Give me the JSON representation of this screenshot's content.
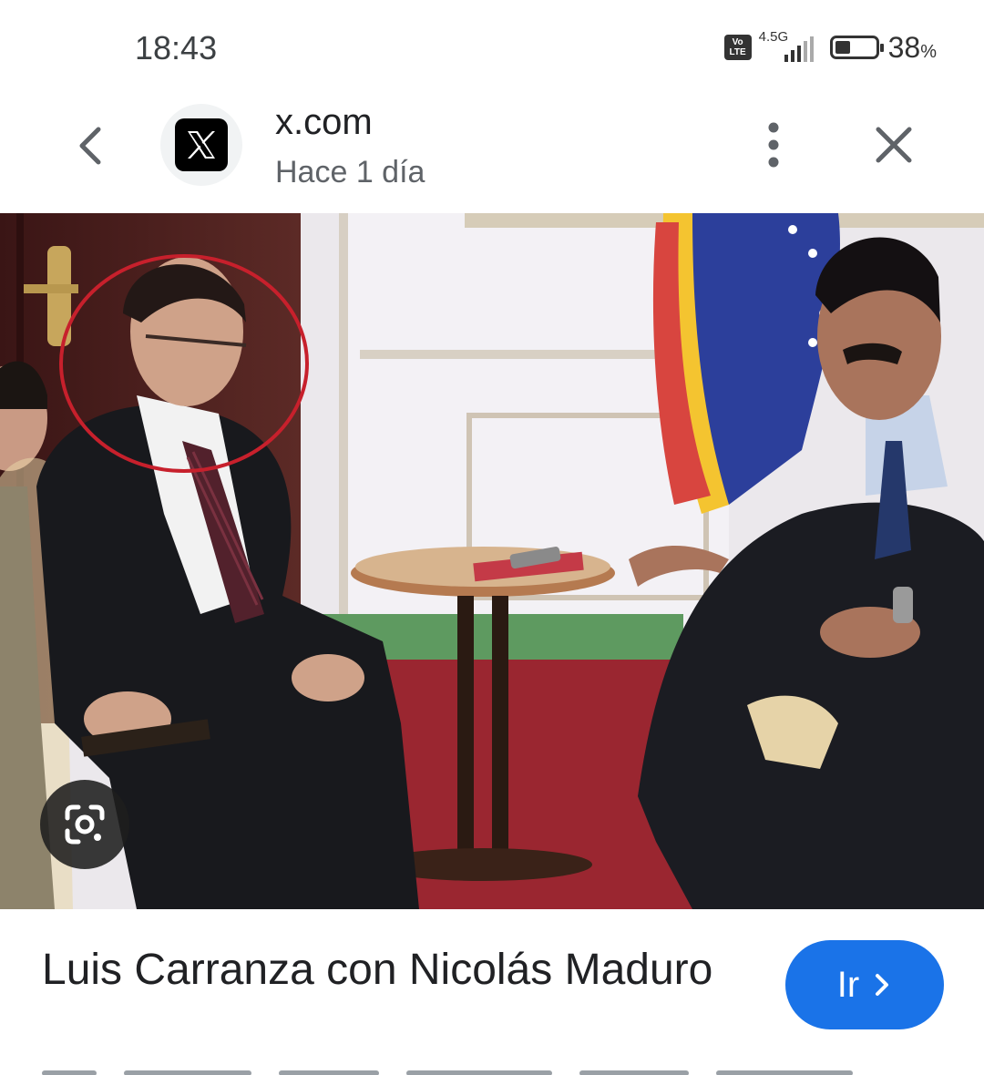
{
  "status_bar": {
    "time": "18:43",
    "volte_label": "Vo LTE",
    "network_label": "4.5G",
    "battery_percent": "38",
    "battery_unit": "%",
    "battery_level": 0.38
  },
  "header": {
    "site": "x.com",
    "time_ago": "Hace 1 día",
    "favicon_icon": "x-logo-icon",
    "back_icon": "chevron-left-icon",
    "more_icon": "more-vert-icon",
    "close_icon": "close-icon"
  },
  "image": {
    "lens_icon": "google-lens-icon",
    "flag_colors": [
      "#f4c430",
      "#2c3f9b",
      "#d8453f"
    ]
  },
  "caption": {
    "title": "Luis Carranza con Nicolás Maduro",
    "go_label": "Ir",
    "go_color": "#1a73e8"
  }
}
